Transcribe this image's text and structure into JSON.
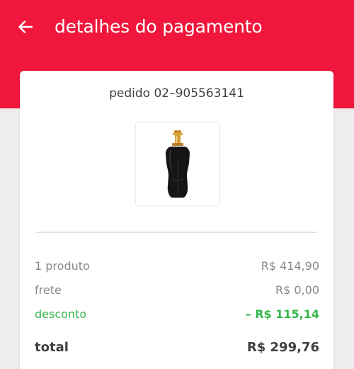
{
  "header": {
    "title": "detalhes do pagamento",
    "accent_color": "#f0163c",
    "back_icon": "arrow-left-icon"
  },
  "order": {
    "label": "pedido 02–905563141",
    "product_image": "perfume-bottle"
  },
  "summary": {
    "products": {
      "label": "1 produto",
      "value": "R$ 414,90"
    },
    "shipping": {
      "label": "frete",
      "value": "R$ 0,00"
    },
    "discount": {
      "label": "desconto",
      "value": "– R$ 115,14",
      "color": "#33b54a"
    },
    "total": {
      "label": "total",
      "value": "R$ 299,76"
    }
  }
}
